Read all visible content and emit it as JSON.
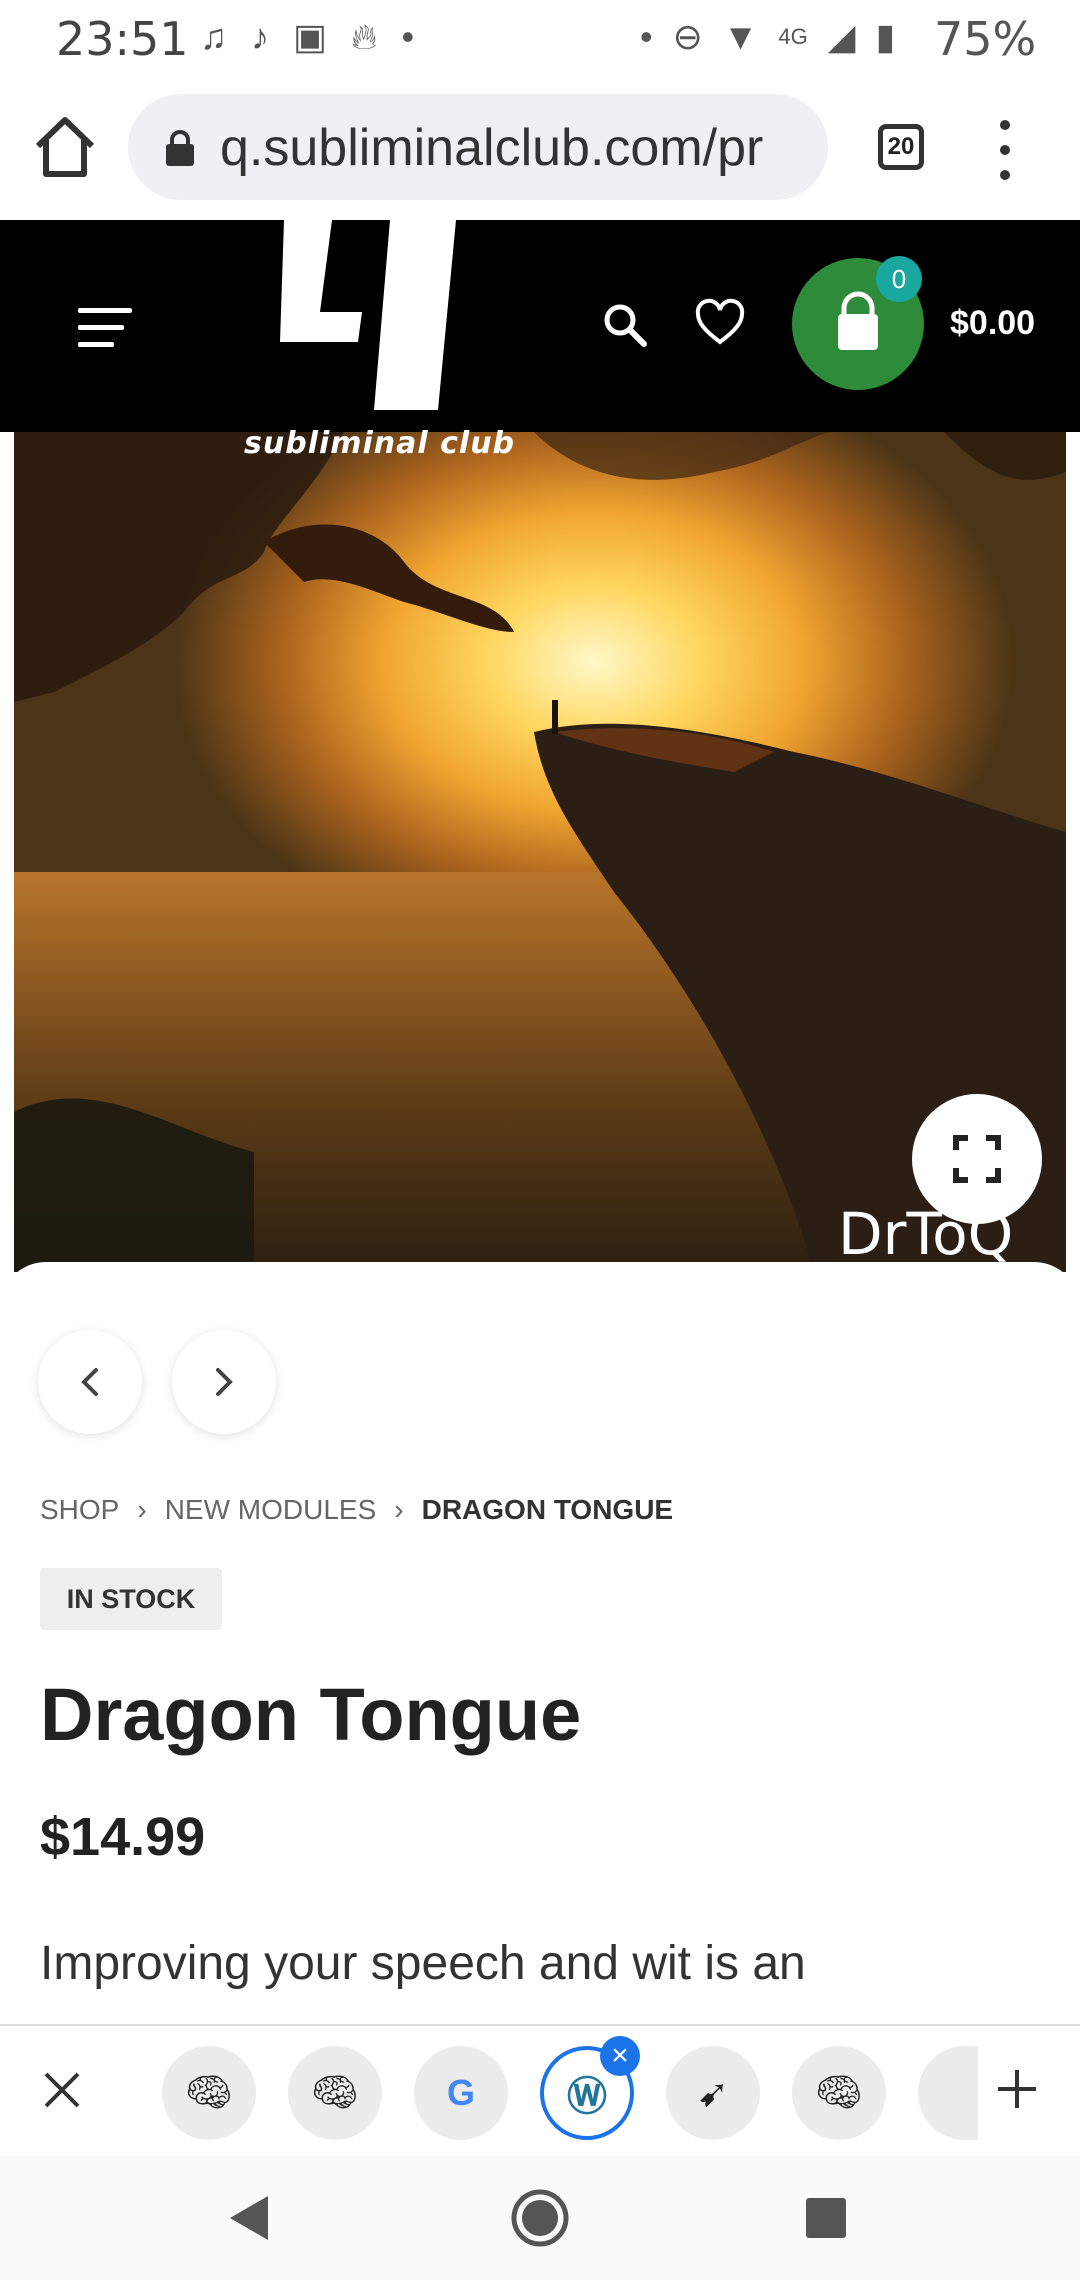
{
  "status_bar": {
    "time": "23:51",
    "battery": "75%",
    "network": "4G"
  },
  "browser": {
    "url": "q.subliminalclub.com/pr",
    "tab_count": "20"
  },
  "site": {
    "name": "subliminal club",
    "cart_count": "0",
    "cart_total": "$0.00",
    "brand_color": "#2e8b3a"
  },
  "hero": {
    "watermark": "DrToQ"
  },
  "breadcrumb": {
    "items": [
      "SHOP",
      "NEW MODULES",
      "DRAGON TONGUE"
    ]
  },
  "product": {
    "stock": "IN STOCK",
    "title": "Dragon Tongue",
    "price": "$14.99",
    "description": "Improving your speech and wit is an"
  },
  "tab_strip": {
    "tabs": [
      {
        "icon": "brain-icon"
      },
      {
        "icon": "brain-icon"
      },
      {
        "icon": "google-icon"
      },
      {
        "icon": "wordpress-icon",
        "active": true
      },
      {
        "icon": "fishing-icon"
      },
      {
        "icon": "brain-icon"
      }
    ]
  }
}
